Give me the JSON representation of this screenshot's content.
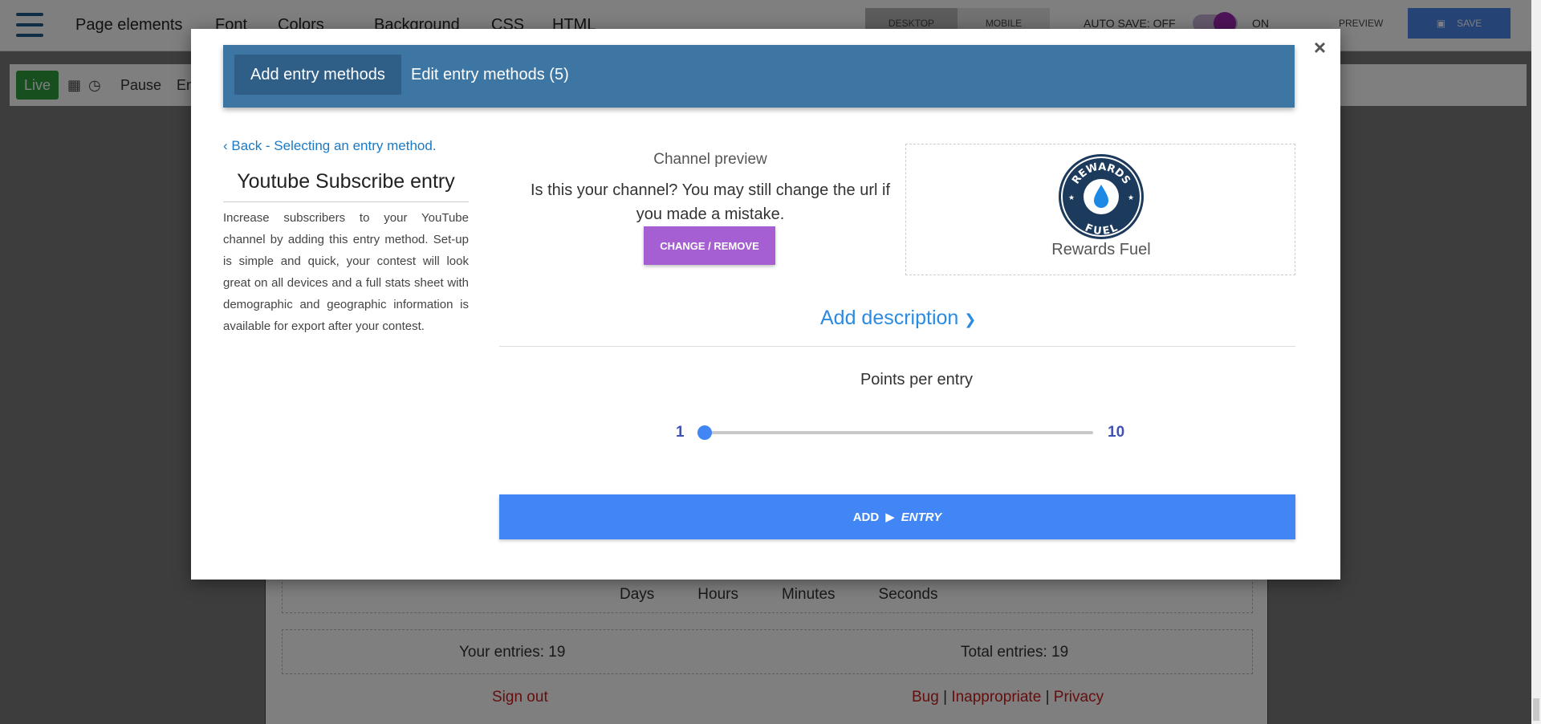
{
  "topbar": {
    "nav": [
      "Page elements",
      "Font",
      "Colors",
      "Background",
      "CSS",
      "HTML"
    ],
    "device_tabs": [
      "DESKTOP",
      "MOBILE"
    ],
    "autosave_label": "AUTO SAVE: OFF",
    "on_label": "ON",
    "preview_label": "PREVIEW",
    "save_label": "SAVE"
  },
  "subbar": {
    "live_label": "Live",
    "pause_label": "Pause",
    "end_label": "En"
  },
  "modal": {
    "close": "×",
    "tabs": [
      "Add entry methods",
      "Edit entry methods (5)"
    ],
    "back_link": "Back - Selecting an entry method.",
    "title": "Youtube Subscribe entry",
    "description": "Increase subscribers to your YouTube channel by adding this entry method. Set-up is simple and quick, your contest will look great on all devices and a full stats sheet with demographic and geographic information is available for export after your contest.",
    "channel_preview_label": "Channel preview",
    "channel_question": "Is this your channel? You may still change the url if you made a mistake.",
    "change_button": "CHANGE / REMOVE",
    "channel_name": "Rewards Fuel",
    "logo_text_top": "REWARDS",
    "logo_text_bottom": "FUEL",
    "add_description": "Add description",
    "points_label": "Points per entry",
    "slider": {
      "min": "1",
      "max": "10",
      "value": 1
    },
    "add_button_pre": "ADD",
    "add_button_post": "ENTRY"
  },
  "page": {
    "countdown_labels": [
      "Days",
      "Hours",
      "Minutes",
      "Seconds"
    ],
    "your_entries": "Your entries: 19",
    "total_entries": "Total entries: 19",
    "sign_out": "Sign out",
    "links": [
      "Bug",
      "Inappropriate",
      "Privacy"
    ],
    "link_separator": "|"
  },
  "colors": {
    "tabbar": "#3d75a3",
    "primary_button": "#4285f4",
    "change_button": "#a55fd2",
    "live_green": "#2e9e3e",
    "footer_link_red": "#cc1b1b"
  }
}
